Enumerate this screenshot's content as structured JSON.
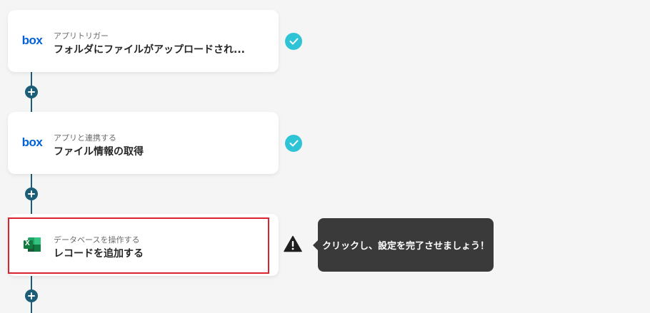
{
  "steps": [
    {
      "app": "box",
      "icon": "box-logo-icon",
      "subtitle": "アプリトリガー",
      "title": "フォルダにファイルがアップロードされ...",
      "status": "completed"
    },
    {
      "app": "box",
      "icon": "box-logo-icon",
      "subtitle": "アプリと連携する",
      "title": "ファイル情報の取得",
      "status": "completed"
    },
    {
      "app": "excel",
      "icon": "excel-logo-icon",
      "subtitle": "データベースを操作する",
      "title": "レコードを追加する",
      "status": "warning"
    }
  ],
  "box_logo_text": "box",
  "excel_logo_letter": "X",
  "tooltip": {
    "text": "クリックし、設定を完了させましょう！"
  },
  "colors": {
    "connector": "#1b5e78",
    "check": "#2ec4d6",
    "highlight": "#d9232e",
    "tooltip_bg": "#3a3a3a",
    "box_brand": "#0061d5",
    "excel_brand": "#1d6f42"
  }
}
